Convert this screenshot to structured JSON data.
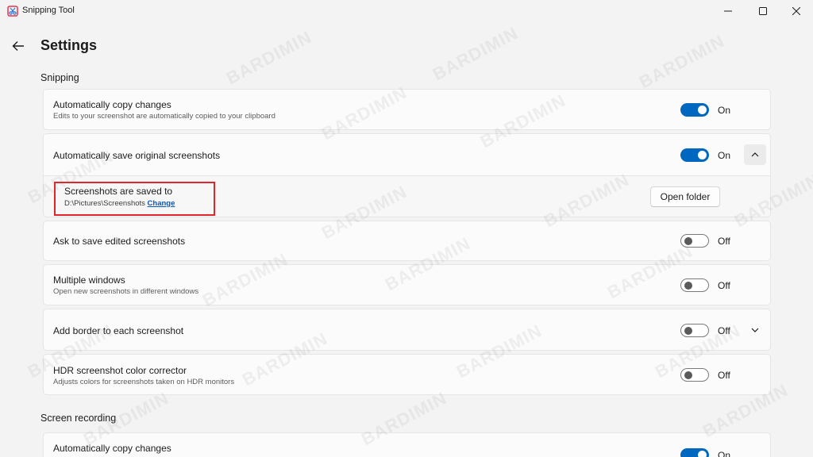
{
  "window": {
    "app_title": "Snipping Tool",
    "minimize_icon": "minimize-icon",
    "maximize_icon": "maximize-icon",
    "close_icon": "close-icon"
  },
  "page": {
    "title": "Settings",
    "back_icon": "arrow-left-icon"
  },
  "sections": {
    "snipping": "Snipping",
    "screen_recording": "Screen recording"
  },
  "settings": [
    {
      "title": "Automatically copy changes",
      "desc": "Edits to your screenshot are automatically copied to your clipboard",
      "state": "On"
    },
    {
      "title": "Automatically save original screenshots",
      "desc": "",
      "state": "On"
    },
    {
      "title": "Ask to save edited screenshots",
      "desc": "",
      "state": "Off"
    },
    {
      "title": "Multiple windows",
      "desc": "Open new screenshots in different windows",
      "state": "Off"
    },
    {
      "title": "Add border to each screenshot",
      "desc": "",
      "state": "Off"
    },
    {
      "title": "HDR screenshot color corrector",
      "desc": "Adjusts colors for screenshots taken on HDR monitors",
      "state": "Off"
    },
    {
      "title": "Automatically copy changes",
      "desc": "",
      "state": "On"
    }
  ],
  "save_location": {
    "title": "Screenshots are saved to",
    "path": "D:\\Pictures\\Screenshots",
    "change_link": "Change",
    "open_folder": "Open folder"
  },
  "watermark": "BARDIMIN",
  "colors": {
    "accent": "#0067c0",
    "highlight": "#e0262c",
    "link": "#0b57b8"
  }
}
